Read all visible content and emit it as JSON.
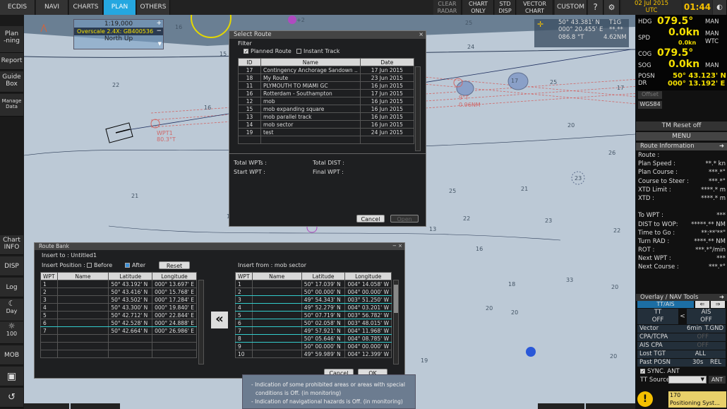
{
  "topbar": {
    "tabs": [
      "ECDIS",
      "NAVI",
      "CHARTS",
      "PLAN",
      "OTHERS"
    ],
    "active": "PLAN",
    "clear_radar": "CLEAR\nRADAR",
    "chart_only": "CHART\nONLY",
    "std_disp": "STD\nDISP",
    "vector_chart": "VECTOR\nCHART",
    "custom": "CUSTOM",
    "date": "02 Jul 2015",
    "tz": "UTC",
    "time": "01:44"
  },
  "left": {
    "planning": "Plan\n-ning",
    "report": "Report",
    "guidebox": "Guide\nBox",
    "manage": "Manage\nData",
    "chartinfo": "Chart\nINFO",
    "disp": "DISP",
    "log": "Log",
    "day": "Day",
    "bright": "100",
    "mob": "MOB"
  },
  "scalebox": {
    "scale": "1:19,000",
    "overscale": "Overscale 2.4X: GB400536",
    "orient": "North  Up"
  },
  "cursor": {
    "lat": "50° 43.381' N",
    "lon": "000° 20.455' E",
    "brg": "086.8 °T",
    "dist": "4.62NM",
    "tgt": "T1G",
    "tgt_val": "**.**"
  },
  "map": {
    "depths": [
      "16",
      "25",
      "24",
      "22",
      "15",
      "16",
      "20",
      "21",
      "19",
      "25",
      "22",
      "13",
      "17",
      "23",
      "26",
      "21",
      "23",
      "16",
      "18",
      "20",
      "20",
      "33",
      "19",
      "22",
      "25",
      "20",
      "20",
      "17"
    ],
    "wpt1": "WPT1",
    "wpt1_course": "80.3°T",
    "wpt_mark": "9°T",
    "wpt_dist": "0.96NM",
    "ring_label": "+2"
  },
  "select_route": {
    "title": "Select Route",
    "filter": "Filter",
    "planned": "Planned Route",
    "instant": "Instant Track",
    "cols": [
      "ID",
      "Name",
      "Date"
    ],
    "rows": [
      [
        "17",
        "Contingency Anchorage Sandown ..",
        "17 Jun 2015"
      ],
      [
        "18",
        "My Route",
        "23 Jun 2015"
      ],
      [
        "11",
        "PLYMOUTH TO MIAMI GC",
        "16 Jun 2015"
      ],
      [
        "16",
        "Rotterdam - Southampton",
        "17 Jun 2015"
      ],
      [
        "12",
        "mob",
        "16 Jun 2015"
      ],
      [
        "15",
        "mob expanding square",
        "16 Jun 2015"
      ],
      [
        "13",
        "mob parallel track",
        "16 Jun 2015"
      ],
      [
        "14",
        "mob sector",
        "16 Jun 2015"
      ],
      [
        "19",
        "test",
        "24 Jun 2015"
      ]
    ],
    "total_wpts": "Total WPTs :",
    "total_dist": "Total DIST :",
    "start_wpt": "Start WPT :",
    "final_wpt": "Final WPT :",
    "cancel": "Cancel",
    "open": "Open"
  },
  "route_bank": {
    "title": "Route Bank",
    "insert_to": "Insert to : Untitled1",
    "insert_pos": "Insert Position :",
    "before": "Before",
    "after": "After",
    "reset": "Reset",
    "insert_from": "Insert from :  mob sector",
    "cols": [
      "WPT",
      "Name",
      "Latitude",
      "Longitude"
    ],
    "left_rows": [
      [
        "1",
        "",
        "50° 43.192' N",
        "000° 13.697' E"
      ],
      [
        "2",
        "",
        "50° 43.416' N",
        "000° 15.768' E"
      ],
      [
        "3",
        "",
        "50° 43.502' N",
        "000° 17.284' E"
      ],
      [
        "4",
        "",
        "50° 43.300' N",
        "000° 19.840' E"
      ],
      [
        "5",
        "",
        "50° 42.712' N",
        "000° 22.844' E"
      ],
      [
        "6",
        "",
        "50° 42.528' N",
        "000° 24.888' E"
      ],
      [
        "7",
        "",
        "50° 42.664' N",
        "000° 26.986' E"
      ]
    ],
    "right_rows": [
      [
        "1",
        "",
        "50° 17.039' N",
        "004° 14.058' W"
      ],
      [
        "2",
        "",
        "50° 00.000' N",
        "004° 00.000' W"
      ],
      [
        "3",
        "",
        "49° 54.343' N",
        "003° 51.250' W"
      ],
      [
        "4",
        "",
        "49° 52.279' N",
        "004° 03.201' W"
      ],
      [
        "5",
        "",
        "50° 07.719' N",
        "003° 56.782' W"
      ],
      [
        "6",
        "",
        "50° 02.058' N",
        "003° 48.015' W"
      ],
      [
        "7",
        "",
        "49° 57.921' N",
        "004° 11.968' W"
      ],
      [
        "8",
        "",
        "50° 05.646' N",
        "004° 08.785' W"
      ],
      [
        "9",
        "",
        "50° 00.000' N",
        "004° 00.000' W"
      ],
      [
        "10",
        "",
        "49° 59.989' N",
        "004° 12.399' W"
      ]
    ],
    "transfer": "«",
    "cancel": "Cancel",
    "ok": "OK"
  },
  "alerts": {
    "line1": "- Indication of some prohibited areas or areas with special",
    "line2": "conditions is Off. (in monitoring)",
    "line3": "- Indication of navigational hazards is Off. (in monitoring)"
  },
  "nav": {
    "hdg_label": "HDG",
    "hdg": "079.5°",
    "hdg_mode": "MAN",
    "spd_label": "SPD",
    "spd": "0.0kn",
    "spd_sub": "0.0kn",
    "spd_mode": "MAN\nWTC",
    "cog_label": "COG",
    "cog": "079.5°",
    "sog_label": "SOG",
    "sog": "0.0kn",
    "sog_mode": "MAN",
    "posn_label": "POSN",
    "dr_label": "DR",
    "lat": "50° 43.123' N",
    "lon": "000° 13.192' E",
    "offset": "Offset",
    "datum": "WGS84",
    "tm_reset": "TM Reset off",
    "menu": "MENU"
  },
  "route_info": {
    "title": "Route Information",
    "rows": [
      [
        "Route :",
        ""
      ],
      [
        "Plan Speed :",
        "**.* kn"
      ],
      [
        "Plan Course :",
        "***.*°"
      ],
      [
        "Course to Steer :",
        "***.*°"
      ],
      [
        "XTD Limit :",
        "****.* m"
      ],
      [
        "XTD :",
        "****.* m"
      ],
      [
        "",
        ""
      ],
      [
        "To WPT :",
        "***"
      ],
      [
        "DIST to WOP:",
        "*****.** NM"
      ],
      [
        "Time to Go :",
        "**:**'**\""
      ],
      [
        "Turn RAD :",
        "****.** NM"
      ],
      [
        "ROT :",
        "***.*°/min"
      ],
      [
        "Next WPT :",
        "***"
      ],
      [
        "Next Course :",
        "***.*°"
      ]
    ]
  },
  "overlay": {
    "title": "Overlay / NAV Tools",
    "ttais": "TT/AIS",
    "tt": "TT",
    "tt_state": "OFF",
    "lt": "<",
    "ais": "AIS",
    "ais_state": "OFF",
    "vector": "Vector",
    "vector_val": "6min",
    "vector_mode": "T.GND",
    "cpa_tcpa": "CPA/TCPA",
    "cpa_val": "OFF",
    "ais_cpa": "AIS CPA",
    "ais_cpa_val": "OFF",
    "lost_tgt": "Lost TGT",
    "lost_val": "ALL",
    "past_posn": "Past POSN",
    "past_val": "30s",
    "past_mode": "REL",
    "sync": "SYNC. ANT",
    "tt_source": "TT Source:",
    "ant": "ANT"
  },
  "alarm": {
    "code": "170",
    "text": "Positioning Syst..."
  }
}
